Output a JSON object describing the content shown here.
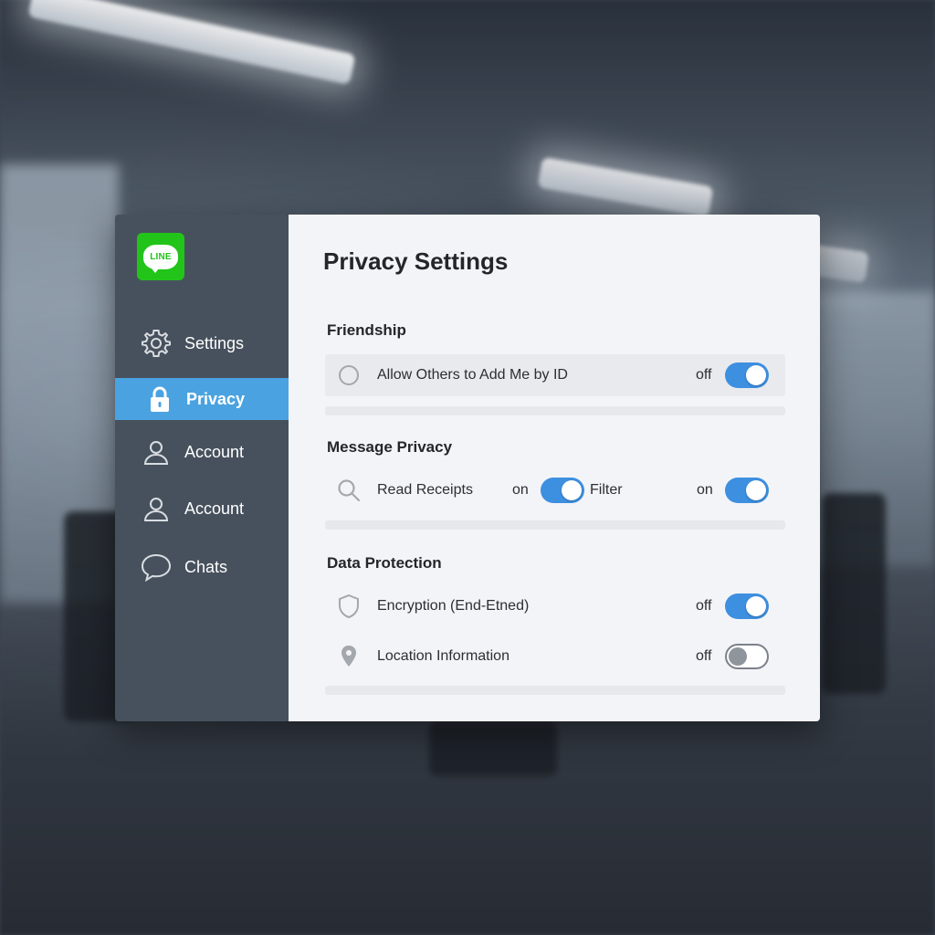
{
  "app": {
    "logo_text": "LINE",
    "brand_color": "#22c41a",
    "accent_color": "#4aa3e0",
    "toggle_color": "#3d8fe0"
  },
  "sidebar": {
    "items": [
      {
        "label": "Settings",
        "icon": "gear-icon",
        "active": false
      },
      {
        "label": "Privacy",
        "icon": "lock-icon",
        "active": true
      },
      {
        "label": "Account",
        "icon": "user-icon",
        "active": false
      },
      {
        "label": "Account",
        "icon": "user-icon",
        "active": false
      },
      {
        "label": "Chats",
        "icon": "chat-bubble-icon",
        "active": false
      }
    ]
  },
  "main": {
    "title": "Privacy Settings",
    "sections": [
      {
        "title": "Friendship",
        "rows": [
          {
            "icon": "radio-circle-icon",
            "label": "Allow Others to Add Me by ID",
            "state": "off",
            "toggle_on": true
          }
        ]
      },
      {
        "title": "Message Privacy",
        "rows": [
          {
            "icon": "search-icon",
            "label": "Read Receipts",
            "state": "on",
            "toggle_on": true,
            "extra_label": "Filter",
            "extra_state": "on",
            "extra_toggle_on": true
          }
        ]
      },
      {
        "title": "Data Protection",
        "rows": [
          {
            "icon": "shield-icon",
            "label": "Encryption (End-Etned)",
            "state": "off",
            "toggle_on": true
          },
          {
            "icon": "location-pin-icon",
            "label": "Location Information",
            "state": "off",
            "toggle_on": false
          }
        ]
      }
    ]
  }
}
